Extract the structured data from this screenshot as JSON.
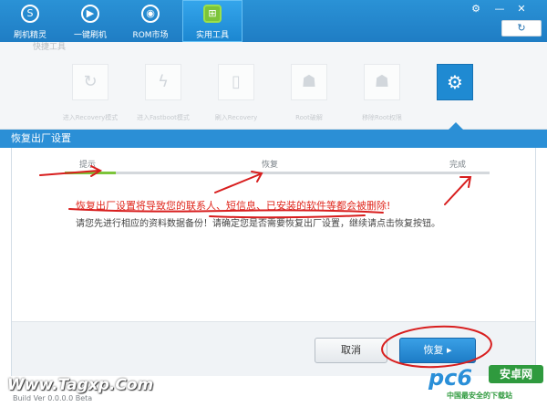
{
  "nav": {
    "tabs": [
      {
        "label": "刷机精灵",
        "icon": "s-logo-icon",
        "glyph": "S"
      },
      {
        "label": "一键刷机",
        "icon": "play-icon",
        "glyph": "▶"
      },
      {
        "label": "ROM市场",
        "icon": "android-icon",
        "glyph": "◉"
      },
      {
        "label": "实用工具",
        "icon": "grid-icon",
        "glyph": "⊞"
      }
    ],
    "active_tab": "实用工具",
    "refresh_glyph": "↻"
  },
  "window": {
    "settings_glyph": "⚙",
    "minimize_glyph": "—",
    "close_glyph": "✕"
  },
  "tools": {
    "section_title": "快捷工具",
    "items": [
      {
        "label": "进入Recovery模式",
        "icon": "refresh-icon",
        "glyph": "↻"
      },
      {
        "label": "进入Fastboot模式",
        "icon": "lightning-icon",
        "glyph": "ϟ"
      },
      {
        "label": "刷入Recovery",
        "icon": "phone-icon",
        "glyph": "▯"
      },
      {
        "label": "Root破解",
        "icon": "android-icon",
        "glyph": "☗"
      },
      {
        "label": "移除Root权限",
        "icon": "android-icon",
        "glyph": "☗"
      },
      {
        "label": "",
        "icon": "gears-icon",
        "glyph": "⚙"
      }
    ]
  },
  "panel": {
    "title": "恢复出厂设置",
    "steps": [
      "提示",
      "恢复",
      "完成"
    ],
    "progress": 0.12,
    "warning": "恢复出厂设置将导致您的联系人、短信息、已安装的软件等都会被删除!",
    "info": "请您先进行相应的资料数据备份！请确定您是否需要恢复出厂设置，继续请点击恢复按钮。"
  },
  "buttons": {
    "cancel": "取消",
    "restore": "恢复 ▸"
  },
  "watermark": {
    "left": "Www.Tagxp.Com",
    "version": "Build Ver 0.0.0.0 Beta",
    "brand": "pc6",
    "brand_tag": "安卓网",
    "slogan": "中国最安全的下载站"
  },
  "colors": {
    "accent": "#2b8fd6",
    "progress": "#7cc43a",
    "warning": "#e0281e",
    "annotation": "#d81e1e"
  }
}
